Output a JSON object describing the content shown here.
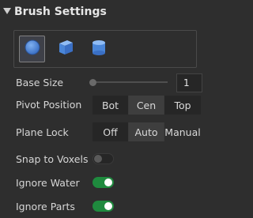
{
  "header": {
    "title": "Brush Settings"
  },
  "shapes": [
    {
      "name": "Sphere",
      "icon": "sphere-icon",
      "selected": true
    },
    {
      "name": "Cube",
      "icon": "cube-icon",
      "selected": false
    },
    {
      "name": "Cylinder",
      "icon": "cylinder-icon",
      "selected": false
    }
  ],
  "base_size": {
    "label": "Base Size",
    "value": "1",
    "slider_fraction": 0.0
  },
  "pivot_position": {
    "label": "Pivot Position",
    "options": [
      "Bot",
      "Cen",
      "Top"
    ],
    "selected": "Cen"
  },
  "plane_lock": {
    "label": "Plane Lock",
    "options": [
      "Off",
      "Auto",
      "Manual"
    ],
    "selected": "Auto"
  },
  "snap_to_voxels": {
    "label": "Snap to Voxels",
    "on": false
  },
  "ignore_water": {
    "label": "Ignore Water",
    "on": true
  },
  "ignore_parts": {
    "label": "Ignore Parts",
    "on": true
  },
  "colors": {
    "accent_on": "#1f8a3e",
    "icon_blue": "#4a86d8",
    "background": "#2e2e2e"
  }
}
